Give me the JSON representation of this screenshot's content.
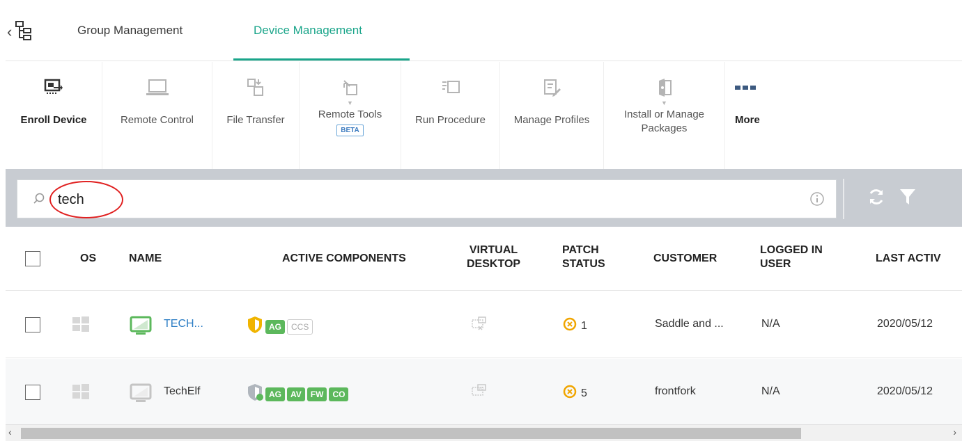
{
  "tabs": [
    {
      "label": "Group Management",
      "active": false
    },
    {
      "label": "Device Management",
      "active": true
    }
  ],
  "toolbar": {
    "enroll": "Enroll Device",
    "remote_control": "Remote Control",
    "file_transfer": "File Transfer",
    "remote_tools": "Remote Tools",
    "remote_tools_badge": "BETA",
    "run_procedure": "Run Procedure",
    "manage_profiles": "Manage Profiles",
    "install_packages_line1": "Install or Manage",
    "install_packages_line2": "Packages",
    "more": "More"
  },
  "search": {
    "value": "tech"
  },
  "table": {
    "headers": {
      "os": "OS",
      "name": "NAME",
      "active_components": "ACTIVE COMPONENTS",
      "virtual_desktop_1": "VIRTUAL",
      "virtual_desktop_2": "DESKTOP",
      "patch_status_1": "PATCH",
      "patch_status_2": "STATUS",
      "customer": "CUSTOMER",
      "logged_in_1": "LOGGED IN",
      "logged_in_2": "USER",
      "last_active": "LAST ACTIV"
    },
    "rows": [
      {
        "name": "TECH...",
        "components": [
          "AG",
          "CCS"
        ],
        "patch": "1",
        "customer": "Saddle and ...",
        "logged_in": "N/A",
        "last_active": "2020/05/12"
      },
      {
        "name": "TechElf",
        "components": [
          "AG",
          "AV",
          "FW",
          "CO"
        ],
        "patch": "5",
        "customer": "frontfork",
        "logged_in": "N/A",
        "last_active": "2020/05/12"
      }
    ]
  },
  "colors": {
    "accent": "#1aa58a",
    "link": "#2a7cc4",
    "badge_green": "#5cb85c",
    "patch_orange": "#f0a500",
    "highlight_red": "#e02020"
  },
  "scrollbar": {
    "left_arrow": "‹",
    "right_arrow": "›"
  }
}
